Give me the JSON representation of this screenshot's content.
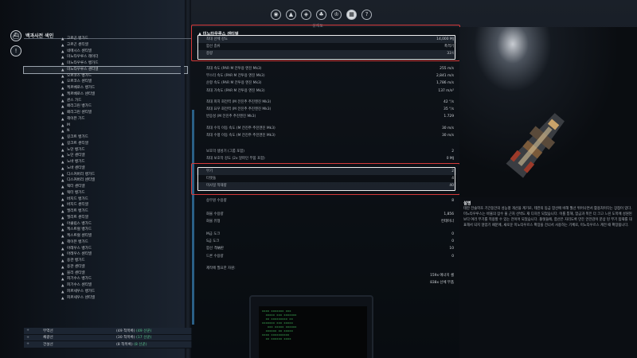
{
  "nav": {
    "icons": [
      "ship-class-icon",
      "fire-icon",
      "medal-icon",
      "tree-icon",
      "trophy-icon",
      "encyclopedia-icon",
      "help-icon"
    ],
    "icon_glyphs": [
      "◉",
      "▲",
      "◈",
      "♣",
      "♔",
      "▦",
      "?"
    ],
    "active_index": 5,
    "subtitle": "설계도"
  },
  "sidebar": {
    "title": "백과사전 색인",
    "items": [
      {
        "hull": "",
        "label": "고르곤 뱅가드"
      },
      {
        "hull": "",
        "label": "고르곤 센티넬"
      },
      {
        "hull": "",
        "label": "네메시스 센티넬"
      },
      {
        "hull": "",
        "label": "미노타우루스 레이더"
      },
      {
        "hull": "",
        "label": "미노타우루스 뱅가드"
      },
      {
        "hull": "",
        "label": "미노타우루스 센티넬",
        "selected": true
      },
      {
        "hull": "",
        "label": "오르코스 뱅가드"
      },
      {
        "hull": "",
        "label": "오르코스 센티넬"
      },
      {
        "hull": "",
        "label": "케르베로스 뱅가드"
      },
      {
        "hull": "",
        "label": "케르베로스 센티넬"
      },
      {
        "hull": "",
        "label": "퀸스 가드"
      },
      {
        "hull": "",
        "label": "페리그린 뱅가드"
      },
      {
        "hull": "",
        "label": "페리그린 센티넬"
      },
      {
        "hull": "",
        "label": "헤이븐 가드"
      },
      {
        "hull": "",
        "label": "M"
      },
      {
        "hull": "",
        "label": "N"
      },
      {
        "hull": "",
        "label": "길크트 뱅가드"
      },
      {
        "hull": "",
        "label": "길크트 센티넬"
      },
      {
        "hull": "",
        "label": "노던 뱅가드"
      },
      {
        "hull": "",
        "label": "노던 센티넬"
      },
      {
        "hull": "",
        "label": "노바 뱅가드"
      },
      {
        "hull": "",
        "label": "노바 센티넬"
      },
      {
        "hull": "",
        "label": "디스커버리 뱅가드"
      },
      {
        "hull": "",
        "label": "디스커버리 센티넬"
      },
      {
        "hull": "",
        "label": "렉터 센티넬"
      },
      {
        "hull": "",
        "label": "렉터 뱅가드"
      },
      {
        "hull": "",
        "label": "버지드 뱅가드"
      },
      {
        "hull": "",
        "label": "버지드 센티넬"
      },
      {
        "hull": "",
        "label": "엘리트 뱅가드"
      },
      {
        "hull": "",
        "label": "엘리트 센티넬"
      },
      {
        "hull": "",
        "label": "아클립스 뱅가드"
      },
      {
        "hull": "",
        "label": "케스트럴 뱅가드"
      },
      {
        "hull": "",
        "label": "케스트럴 센티넬"
      },
      {
        "hull": "",
        "label": "헤이븐 뱅가드"
      },
      {
        "hull": "",
        "label": "아레우스 뱅가드"
      },
      {
        "hull": "",
        "label": "아레우스 센티넬"
      },
      {
        "hull": "",
        "label": "용관 뱅가드"
      },
      {
        "hull": "",
        "label": "용관 센티넬"
      },
      {
        "hull": "",
        "label": "블리 센티넬"
      },
      {
        "hull": "",
        "label": "피기수스 뱅가드"
      },
      {
        "hull": "",
        "label": "피기수스 센티넬"
      },
      {
        "hull": "",
        "label": "피르세우스 뱅가드"
      },
      {
        "hull": "",
        "label": "피르세우스 센티넬"
      }
    ],
    "categories": [
      {
        "plus": "+",
        "name": "무역선",
        "count": "(49 척목록) ",
        "green": "(49 선꾼)"
      },
      {
        "plus": "+",
        "name": "채광선",
        "count": "(30 척목록) ",
        "green": "(17 선꾼)"
      },
      {
        "plus": "+",
        "name": "건설선",
        "count": "(8 척목록) ",
        "green": "(8 선꾼)"
      }
    ]
  },
  "ship": {
    "name": "미노타우루스 센티넬",
    "box1": [
      {
        "label": "최대 선체 강도",
        "value": "14,000 MJ"
      },
      {
        "label": "함선 종류",
        "value": "폭격기"
      },
      {
        "label": "중량",
        "value": "33 t"
      }
    ],
    "stats_a": [
      {
        "label": "최대 속도 (PAR M 전투용 엔진 Mk3)",
        "value": "255 m/s"
      },
      {
        "label": "부스터 속도 (PAR M 전투용 엔진 Mk3)",
        "value": "2,841 m/s"
      },
      {
        "label": "순항 속도 (PAR M 전투용 엔진 Mk3)",
        "value": "1,786 m/s"
      },
      {
        "label": "최대 가속도 (PAR M 전투용 엔진 Mk3)",
        "value": "137 m/s²"
      }
    ],
    "stats_b": [
      {
        "label": "최대 피치 회전력 (M 전진추 추진엔진 Mk3)",
        "value": "42 °/s"
      },
      {
        "label": "최대 요우 회전력 (M 전진추 추진엔진 Mk3)",
        "value": "35 °/s"
      },
      {
        "label": "반응성 (M 전진추 추진엔진 Mk3)",
        "value": "1.729"
      }
    ],
    "stats_c": [
      {
        "label": "최대 수직 이동 속도 (M 전진추 추진엔진 Mk3)",
        "value": "30 m/s"
      },
      {
        "label": "최대 수평 이동 속도 (M 전진추 추진엔진 Mk3)",
        "value": "30 m/s"
      }
    ],
    "stats_d": [
      {
        "label": "보호막 생성기 (그룹 포함)",
        "value": "2"
      },
      {
        "label": "최대 보호막 강도 (2x 알파인 부품 포함)",
        "value": "0 MJ"
      }
    ],
    "box2": [
      {
        "label": "무기",
        "value": "2"
      },
      {
        "label": "터렛들",
        "value": "4"
      },
      {
        "label": "미사일 적재량",
        "value": "40"
      }
    ],
    "stats_e": [
      {
        "label": "승무원 수용량",
        "value": "8"
      }
    ],
    "stats_f": [
      {
        "label": "화물 수용량",
        "value": "1,856"
      },
      {
        "label": "화물 유형",
        "value": "컨테이너"
      }
    ],
    "stats_g": [
      {
        "label": "M급 도크",
        "value": "0"
      },
      {
        "label": "S급 도크",
        "value": "0"
      },
      {
        "label": "함선 격納판",
        "value": "10"
      },
      {
        "label": "드론 수용량",
        "value": "0"
      }
    ],
    "materials_label": "제작에 필요한 자원:",
    "materials": [
      "159x 에너지 셀",
      "838x 선체 부품"
    ]
  },
  "description": {
    "title": "설명",
    "text": "테란 전술학조 기간동안의 성능평 개선을 계기로, 테란의 동급 함선에 비해 월선 뛰어나면서 활용처이다는 장점이 있다. 미노타우루스는 바울의 잠수 물 근처 선박도 재 디자인 되었습니다. 이를 통해, 함급과 폭은 더 크고 느린 도목에 성원된 보다 여러 무기를 적용할 수 있는 전이어 되었습니다. 폴렛들에, 함선은 자리도록 만든 안전감이 문상 된 무기 탑재를 대표해서 되지 않았기 때문에, 새로운 미노타우르스 확장을 건너서 사용하는 기체로, 미노타우르스 계전 때 확장됩니다."
  }
}
